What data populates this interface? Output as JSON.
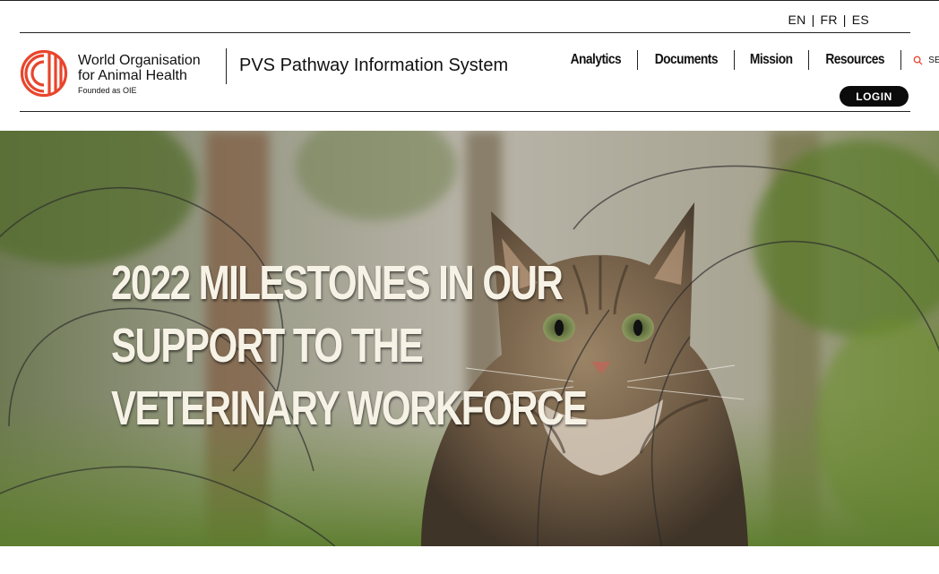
{
  "languages": [
    "EN",
    "FR",
    "ES"
  ],
  "org": {
    "name_line1": "World Organisation",
    "name_line2": "for Animal Health",
    "founded": "Founded as OIE",
    "logo_color": "#e8452c"
  },
  "site_title": "PVS Pathway Information System",
  "nav": {
    "items": [
      "Analytics",
      "Documents",
      "Mission",
      "Resources"
    ],
    "search_label": "SEARCH"
  },
  "login_label": "LOGIN",
  "hero": {
    "title_lines": [
      "2022 MILESTONES IN OUR",
      "SUPPORT TO THE",
      "VETERINARY WORKFORCE"
    ]
  }
}
